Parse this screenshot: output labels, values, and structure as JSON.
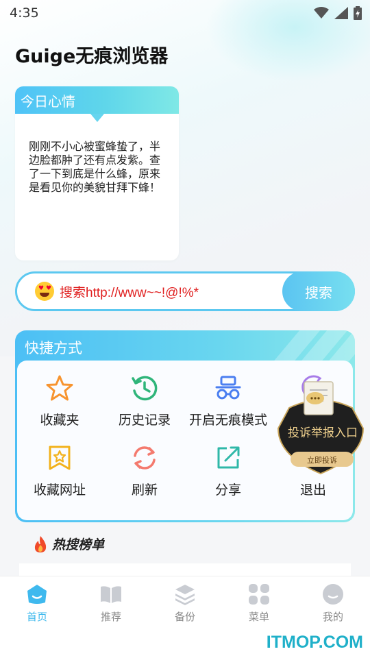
{
  "status_bar": {
    "time": "4:35"
  },
  "app": {
    "title": "Guige无痕浏览器"
  },
  "mood": {
    "header": "今日心情",
    "text": "刚刚不小心被蜜蜂蛰了，半边脸都肿了还有点发紫。查了一下到底是什么蜂，原来是看见你的美貌甘拜下蜂！"
  },
  "search": {
    "value": "搜索http://www~~!@!%*",
    "button_label": "搜索"
  },
  "shortcuts": {
    "title": "快捷方式",
    "items": [
      {
        "label": "收藏夹",
        "icon": "star-icon"
      },
      {
        "label": "历史记录",
        "icon": "history-icon"
      },
      {
        "label": "开启无痕模式",
        "icon": "incognito-icon"
      },
      {
        "label": "",
        "icon": "moon-icon"
      },
      {
        "label": "收藏网址",
        "icon": "bookmark-icon"
      },
      {
        "label": "刷新",
        "icon": "refresh-icon"
      },
      {
        "label": "分享",
        "icon": "share-icon"
      },
      {
        "label": "退出",
        "icon": "exit-icon"
      }
    ]
  },
  "complaint": {
    "title": "投诉举报入口",
    "button": "立即投诉"
  },
  "hot": {
    "title": "热搜榜单"
  },
  "nav": {
    "items": [
      {
        "label": "首页",
        "active": true
      },
      {
        "label": "推荐"
      },
      {
        "label": "备份"
      },
      {
        "label": "菜单"
      },
      {
        "label": "我的"
      }
    ]
  },
  "watermark": "ITMOP.COM",
  "colors": {
    "accent": "#39b7ec",
    "search_text": "#e02020",
    "gradient_start": "#4cbff5",
    "gradient_end": "#8ce8ea"
  }
}
